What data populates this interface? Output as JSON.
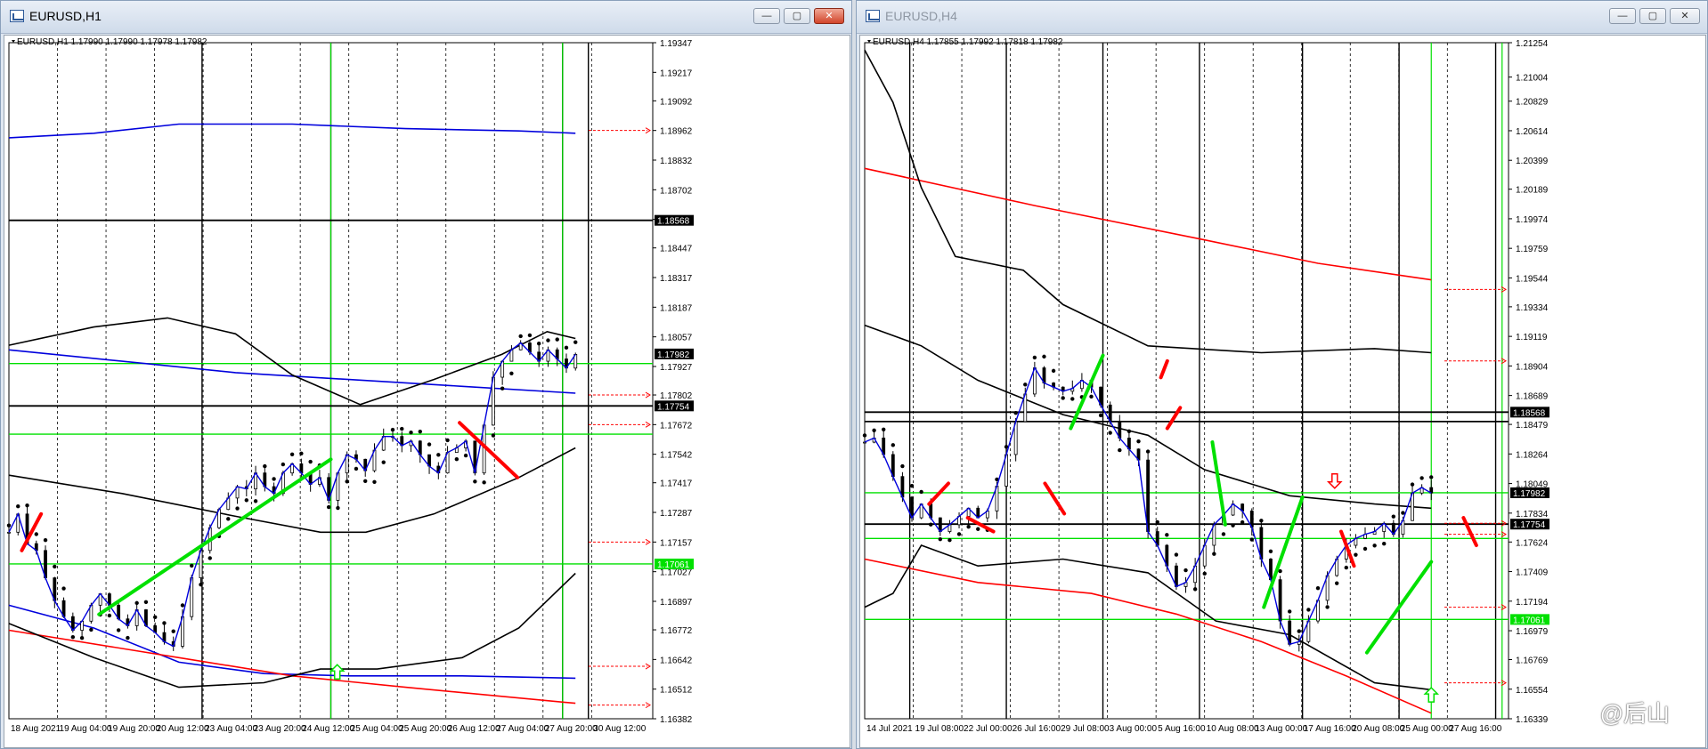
{
  "windows": [
    {
      "title": "EURUSD,H1",
      "active": true
    },
    {
      "title": "EURUSD,H4",
      "active": false
    }
  ],
  "buttons": {
    "minimize": "—",
    "restore": "▢",
    "close": "✕"
  },
  "watermark": "@后山",
  "colors": {
    "green": "#00e000",
    "red": "#ff0000",
    "blue": "#0000dd",
    "black": "#000000",
    "cyan": "#00d8ff"
  },
  "chart_data": [
    {
      "type": "candlestick",
      "symbol": "EURUSD",
      "timeframe": "H1",
      "header": "EURUSD,H1  1.17990 1.17990 1.17978 1.17982",
      "ylim": [
        1.16382,
        1.19347
      ],
      "y_ticks": [
        "1.19347",
        "1.19217",
        "1.19092",
        "1.18962",
        "1.18832",
        "1.18702",
        "1.18572",
        "1.18447",
        "1.18317",
        "1.18187",
        "1.18057",
        "1.17927",
        "1.17802",
        "1.17672",
        "1.17542",
        "1.17417",
        "1.17287",
        "1.17157",
        "1.17027",
        "1.16897",
        "1.16772",
        "1.16642",
        "1.16512",
        "1.16382"
      ],
      "x_ticks": [
        "18 Aug 2021",
        "19 Aug 04:00",
        "19 Aug 20:00",
        "20 Aug 12:00",
        "23 Aug 04:00",
        "23 Aug 20:00",
        "24 Aug 12:00",
        "25 Aug 04:00",
        "25 Aug 20:00",
        "26 Aug 12:00",
        "27 Aug 04:00",
        "27 Aug 20:00",
        "30 Aug 12:00"
      ],
      "price_tags": [
        {
          "value": 1.18568,
          "label": "1.18568",
          "style": "black"
        },
        {
          "value": 1.17982,
          "label": "1.17982",
          "style": "black"
        },
        {
          "value": 1.17754,
          "label": "1.17754",
          "style": "black"
        },
        {
          "value": 1.17061,
          "label": "1.17061",
          "style": "green"
        }
      ],
      "price_path": [
        1.172,
        1.1728,
        1.1715,
        1.1712,
        1.17,
        1.169,
        1.1683,
        1.1677,
        1.1681,
        1.1688,
        1.1693,
        1.1688,
        1.1682,
        1.1679,
        1.1686,
        1.1679,
        1.1676,
        1.1672,
        1.167,
        1.1683,
        1.17,
        1.1712,
        1.1722,
        1.173,
        1.1735,
        1.174,
        1.1739,
        1.1746,
        1.174,
        1.1737,
        1.1746,
        1.175,
        1.1746,
        1.1741,
        1.1744,
        1.1734,
        1.1746,
        1.1754,
        1.1752,
        1.1747,
        1.1756,
        1.1762,
        1.1762,
        1.1758,
        1.176,
        1.1754,
        1.1749,
        1.1746,
        1.1755,
        1.1757,
        1.176,
        1.1746,
        1.1767,
        1.1788,
        1.1795,
        1.18,
        1.1803,
        1.1799,
        1.1795,
        1.18,
        1.1796,
        1.1792,
        1.1798
      ],
      "series": [
        {
          "name": "blue MA upper",
          "color": "#0000dd",
          "x": [
            0,
            0.15,
            0.3,
            0.5,
            0.7,
            0.9,
            1
          ],
          "values": [
            1.1893,
            1.1895,
            1.1899,
            1.1899,
            1.1897,
            1.1896,
            1.1895
          ]
        },
        {
          "name": "blue MA mid",
          "color": "#0000dd",
          "x": [
            0,
            0.2,
            0.4,
            0.6,
            0.8,
            1
          ],
          "values": [
            1.18,
            1.1795,
            1.179,
            1.1787,
            1.1784,
            1.1781
          ]
        },
        {
          "name": "blue MA lower",
          "color": "#0000dd",
          "x": [
            0,
            0.15,
            0.3,
            0.45,
            0.6,
            0.8,
            1
          ],
          "values": [
            1.1688,
            1.1678,
            1.1663,
            1.1658,
            1.1657,
            1.1657,
            1.1656
          ]
        },
        {
          "name": "red MA",
          "color": "#ff0000",
          "x": [
            0,
            0.3,
            0.5,
            0.7,
            1
          ],
          "values": [
            1.1677,
            1.1665,
            1.1657,
            1.1652,
            1.1645
          ]
        },
        {
          "name": "band upper",
          "color": "#000000",
          "x": [
            0,
            0.15,
            0.28,
            0.4,
            0.5,
            0.62,
            0.75,
            0.87,
            0.95,
            1
          ],
          "values": [
            1.1802,
            1.181,
            1.1814,
            1.1807,
            1.1789,
            1.1776,
            1.1787,
            1.1798,
            1.1808,
            1.1805
          ]
        },
        {
          "name": "band mid",
          "color": "#000000",
          "x": [
            0,
            0.2,
            0.4,
            0.55,
            0.63,
            0.75,
            0.9,
            1
          ],
          "values": [
            1.1745,
            1.1737,
            1.1727,
            1.172,
            1.172,
            1.1728,
            1.1744,
            1.1757
          ]
        },
        {
          "name": "band lower",
          "color": "#000000",
          "x": [
            0,
            0.15,
            0.3,
            0.45,
            0.55,
            0.65,
            0.8,
            0.9,
            1
          ],
          "values": [
            1.168,
            1.1665,
            1.1652,
            1.1654,
            1.166,
            1.166,
            1.1665,
            1.1678,
            1.1702
          ]
        }
      ],
      "segments": [
        {
          "color": "green",
          "x0": 0.14,
          "y0": 1.1684,
          "x1": 0.5,
          "y1": 1.1752
        },
        {
          "color": "red",
          "x0": 0.7,
          "y0": 1.1768,
          "x1": 0.79,
          "y1": 1.1744
        },
        {
          "color": "red",
          "x0": 0.02,
          "y0": 1.1712,
          "x1": 0.05,
          "y1": 1.1728
        }
      ],
      "markers": [
        {
          "type": "arrow-up",
          "color": "green",
          "x": 0.51,
          "value": 1.1658
        }
      ],
      "period_separators": [
        0.3,
        0.5,
        0.86,
        0.9
      ],
      "green_verticals": [
        0.5,
        0.86
      ],
      "horizontal_lines": [
        {
          "value": 1.18568,
          "color": "black"
        },
        {
          "value": 1.1794,
          "color": "green"
        },
        {
          "value": 1.17754,
          "color": "black"
        },
        {
          "value": 1.1763,
          "color": "green"
        },
        {
          "value": 1.17061,
          "color": "green"
        }
      ],
      "red_dashed_levels": [
        1.18962,
        1.17802,
        1.17672,
        1.17157,
        1.16612,
        1.16442
      ]
    },
    {
      "type": "candlestick",
      "symbol": "EURUSD",
      "timeframe": "H4",
      "header": "EURUSD,H4  1.17855 1.17992 1.17818 1.17982",
      "ylim": [
        1.16339,
        1.21254
      ],
      "y_ticks": [
        "1.21254",
        "1.21004",
        "1.20829",
        "1.20614",
        "1.20399",
        "1.20189",
        "1.19974",
        "1.19759",
        "1.19544",
        "1.19334",
        "1.19119",
        "1.18904",
        "1.18689",
        "1.18479",
        "1.18264",
        "1.18049",
        "1.17834",
        "1.17624",
        "1.17409",
        "1.17194",
        "1.16979",
        "1.16769",
        "1.16554",
        "1.16339"
      ],
      "x_ticks": [
        "14 Jul 2021",
        "19 Jul 08:00",
        "22 Jul 00:00",
        "26 Jul 16:00",
        "29 Jul 08:00",
        "3 Aug 00:00",
        "5 Aug 16:00",
        "10 Aug 08:00",
        "13 Aug 00:00",
        "17 Aug 16:00",
        "20 Aug 08:00",
        "25 Aug 00:00",
        "27 Aug 16:00"
      ],
      "price_tags": [
        {
          "value": 1.18568,
          "label": "1.18568",
          "style": "black"
        },
        {
          "value": 1.17982,
          "label": "1.17982",
          "style": "black"
        },
        {
          "value": 1.17754,
          "label": "1.17754",
          "style": "black"
        },
        {
          "value": 1.17061,
          "label": "1.17061",
          "style": "green"
        }
      ],
      "price_path": [
        1.1835,
        1.1838,
        1.1826,
        1.181,
        1.1795,
        1.178,
        1.179,
        1.178,
        1.177,
        1.1775,
        1.1781,
        1.1787,
        1.178,
        1.1785,
        1.1803,
        1.1826,
        1.185,
        1.187,
        1.1889,
        1.1878,
        1.1875,
        1.1872,
        1.1874,
        1.188,
        1.1875,
        1.1862,
        1.185,
        1.1838,
        1.183,
        1.1822,
        1.177,
        1.176,
        1.1745,
        1.173,
        1.1733,
        1.1745,
        1.176,
        1.1775,
        1.1782,
        1.179,
        1.1785,
        1.1773,
        1.175,
        1.1735,
        1.1705,
        1.1688,
        1.169,
        1.1705,
        1.172,
        1.1738,
        1.175,
        1.176,
        1.1765,
        1.1768,
        1.177,
        1.1776,
        1.1768,
        1.1778,
        1.1798,
        1.1802,
        1.1798
      ],
      "series": [
        {
          "name": "red MA upper",
          "color": "#ff0000",
          "x": [
            0,
            0.3,
            0.6,
            0.8,
            1
          ],
          "values": [
            1.2034,
            1.2007,
            1.1982,
            1.1965,
            1.1953
          ]
        },
        {
          "name": "red MA lower",
          "color": "#ff0000",
          "x": [
            0,
            0.2,
            0.4,
            0.55,
            0.7,
            0.85,
            1
          ],
          "values": [
            1.175,
            1.1733,
            1.1725,
            1.171,
            1.169,
            1.1665,
            1.1638
          ]
        },
        {
          "name": "band outer",
          "color": "#000000",
          "x": [
            0,
            0.05,
            0.1,
            0.16,
            0.28,
            0.35,
            0.5,
            0.7,
            0.9,
            1
          ],
          "values": [
            1.212,
            1.2082,
            1.202,
            1.197,
            1.196,
            1.1935,
            1.1905,
            1.19,
            1.1903,
            1.19
          ]
        },
        {
          "name": "band upper",
          "color": "#000000",
          "x": [
            0,
            0.1,
            0.2,
            0.35,
            0.5,
            0.6,
            0.75,
            0.9,
            1
          ],
          "values": [
            1.192,
            1.1905,
            1.188,
            1.1855,
            1.184,
            1.1815,
            1.1796,
            1.179,
            1.1787
          ]
        },
        {
          "name": "band lower",
          "color": "#000000",
          "x": [
            0,
            0.05,
            0.1,
            0.2,
            0.35,
            0.5,
            0.62,
            0.75,
            0.9,
            1
          ],
          "values": [
            1.1715,
            1.1725,
            1.176,
            1.1745,
            1.175,
            1.174,
            1.1705,
            1.1695,
            1.166,
            1.1655
          ]
        }
      ],
      "segments": [
        {
          "color": "green",
          "x0": 0.32,
          "y0": 1.1845,
          "x1": 0.37,
          "y1": 1.1898
        },
        {
          "color": "green",
          "x0": 0.54,
          "y0": 1.1835,
          "x1": 0.56,
          "y1": 1.1775
        },
        {
          "color": "green",
          "x0": 0.62,
          "y0": 1.1715,
          "x1": 0.68,
          "y1": 1.1795
        },
        {
          "color": "green",
          "x0": 0.78,
          "y0": 1.1682,
          "x1": 0.88,
          "y1": 1.1748
        },
        {
          "color": "red",
          "x0": 0.46,
          "y0": 1.1882,
          "x1": 0.47,
          "y1": 1.1894
        },
        {
          "color": "red",
          "x0": 0.47,
          "y0": 1.1845,
          "x1": 0.49,
          "y1": 1.186
        },
        {
          "color": "red",
          "x0": 0.1,
          "y0": 1.179,
          "x1": 0.13,
          "y1": 1.1805
        },
        {
          "color": "red",
          "x0": 0.16,
          "y0": 1.178,
          "x1": 0.2,
          "y1": 1.177
        },
        {
          "color": "red",
          "x0": 0.28,
          "y0": 1.1805,
          "x1": 0.31,
          "y1": 1.1783
        },
        {
          "color": "red",
          "x0": 0.74,
          "y0": 1.177,
          "x1": 0.76,
          "y1": 1.1745
        },
        {
          "color": "red",
          "x0": 0.93,
          "y0": 1.178,
          "x1": 0.95,
          "y1": 1.176
        }
      ],
      "markers": [
        {
          "type": "arrow-down",
          "color": "red",
          "x": 0.73,
          "value": 1.1808
        },
        {
          "type": "arrow-up",
          "color": "green",
          "x": 0.88,
          "value": 1.165
        }
      ],
      "period_separators": [
        0.07,
        0.22,
        0.37,
        0.52,
        0.68,
        0.83,
        0.98
      ],
      "green_verticals": [
        0.88,
        0.99
      ],
      "horizontal_lines": [
        {
          "value": 1.18568,
          "color": "black"
        },
        {
          "value": 1.185,
          "color": "black"
        },
        {
          "value": 1.17982,
          "color": "green"
        },
        {
          "value": 1.17754,
          "color": "black"
        },
        {
          "value": 1.1765,
          "color": "green"
        },
        {
          "value": 1.17061,
          "color": "green"
        }
      ],
      "red_dashed_levels": [
        1.1946,
        1.1894,
        1.1776,
        1.1768,
        1.1715,
        1.166
      ]
    }
  ]
}
